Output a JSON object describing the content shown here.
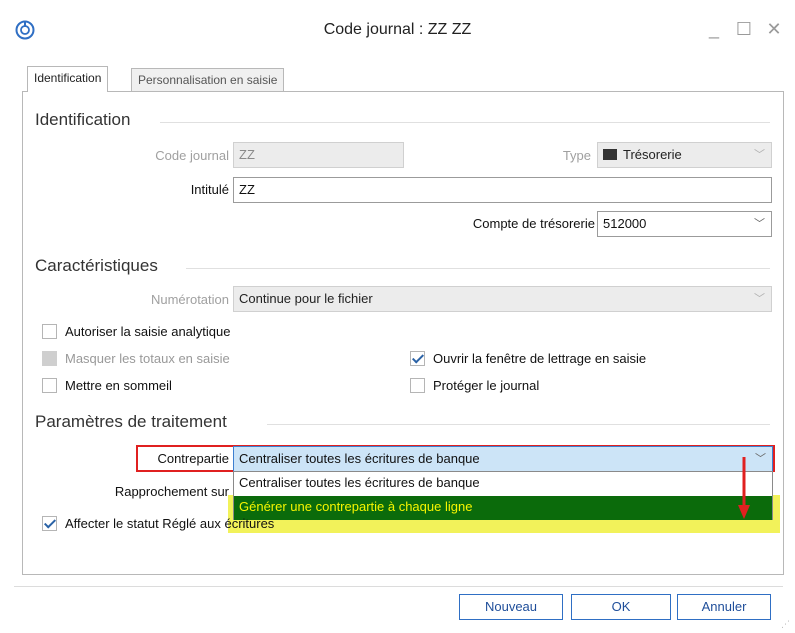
{
  "window": {
    "title": "Code journal : ZZ ZZ",
    "icons": {
      "app": "app-logo-icon",
      "minimize": "minimize-icon",
      "maximize": "maximize-icon",
      "close": "close-icon"
    },
    "min_glyph": "_",
    "max_glyph": "☐",
    "close_glyph": "✕"
  },
  "tabs": [
    {
      "label": "Identification",
      "active": true
    },
    {
      "label": "Personnalisation en saisie",
      "active": false
    }
  ],
  "identification": {
    "section_title": "Identification",
    "code_journal_label": "Code journal",
    "code_journal_value": "ZZ",
    "type_label": "Type",
    "type_value": "Trésorerie",
    "type_icon": "journal-type-icon",
    "intitule_label": "Intitulé",
    "intitule_value": "ZZ",
    "compte_label": "Compte de trésorerie",
    "compte_value": "512000"
  },
  "caracteristiques": {
    "section_title": "Caractéristiques",
    "numerotation_label": "Numérotation",
    "numerotation_value": "Continue pour le fichier",
    "checks": {
      "analytique": {
        "label": "Autoriser la saisie analytique",
        "checked": false,
        "enabled": true
      },
      "masquer": {
        "label": "Masquer les totaux en saisie",
        "checked": false,
        "enabled": false
      },
      "sommeil": {
        "label": "Mettre en sommeil",
        "checked": false,
        "enabled": true
      },
      "lettrage": {
        "label": "Ouvrir la fenêtre de lettrage en saisie",
        "checked": true,
        "enabled": true
      },
      "proteger": {
        "label": "Protéger le journal",
        "checked": false,
        "enabled": true
      }
    }
  },
  "parametres": {
    "section_title": "Paramètres de traitement",
    "contrepartie_label": "Contrepartie",
    "contrepartie_value": "Centraliser toutes les écritures de banque",
    "contrepartie_options": [
      "Centraliser toutes les écritures de banque",
      "Générer une contrepartie à chaque ligne"
    ],
    "rapprochement_label": "Rapprochement sur",
    "statut_label": "Affecter le statut Réglé aux écritures",
    "statut_checked": true
  },
  "buttons": {
    "nouveau": "Nouveau",
    "ok": "OK",
    "annuler": "Annuler"
  },
  "colors": {
    "highlight_red": "#e02020",
    "selected_bg": "#0b6b0b",
    "selected_fg": "#f5f500",
    "marker_yellow": "#f2f25a",
    "button_border": "#2f6fc4"
  }
}
